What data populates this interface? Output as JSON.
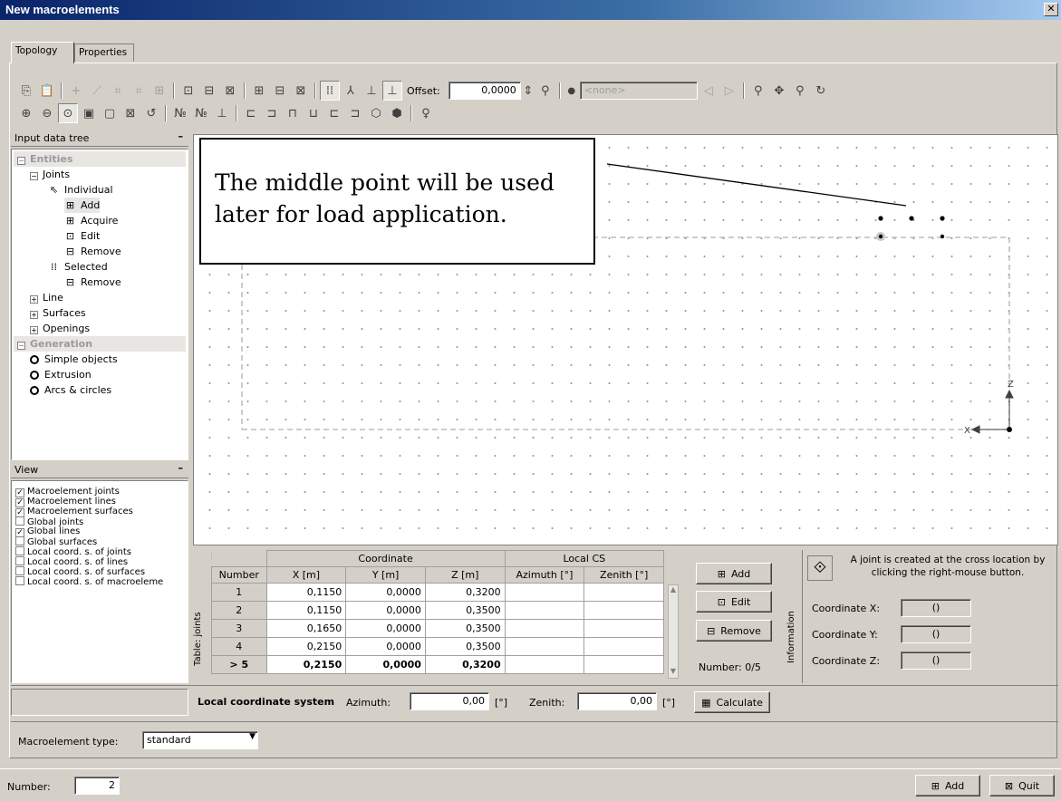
{
  "window": {
    "title": "New macroelements",
    "close_glyph": "✕"
  },
  "tabs": [
    {
      "label": "Topology",
      "active": true
    },
    {
      "label": "Properties",
      "active": false
    }
  ],
  "toolbar": {
    "offset_label": "Offset:",
    "offset_value": "0,0000",
    "none_select": "<none>"
  },
  "tree": {
    "header": "Input data tree",
    "items": [
      {
        "label": "Entities"
      },
      {
        "label": "Joints"
      },
      {
        "label": "Individual"
      },
      {
        "label": "Add"
      },
      {
        "label": "Acquire"
      },
      {
        "label": "Edit"
      },
      {
        "label": "Remove"
      },
      {
        "label": "Selected"
      },
      {
        "label": "Remove"
      },
      {
        "label": "Line"
      },
      {
        "label": "Surfaces"
      },
      {
        "label": "Openings"
      },
      {
        "label": "Generation"
      },
      {
        "label": "Simple objects"
      },
      {
        "label": "Extrusion"
      },
      {
        "label": "Arcs & circles"
      }
    ]
  },
  "view": {
    "header": "View",
    "items": [
      {
        "label": "Macroelement joints",
        "checked": true
      },
      {
        "label": "Macroelement lines",
        "checked": true
      },
      {
        "label": "Macroelement surfaces",
        "checked": true
      },
      {
        "label": "Global joints",
        "checked": false
      },
      {
        "label": "Global lines",
        "checked": true
      },
      {
        "label": "Global surfaces",
        "checked": false
      },
      {
        "label": "Local coord. s. of joints",
        "checked": false
      },
      {
        "label": "Local coord. s. of lines",
        "checked": false
      },
      {
        "label": "Local coord. s. of surfaces",
        "checked": false
      },
      {
        "label": "Local coord. s. of macroeleme",
        "checked": false
      }
    ]
  },
  "canvas": {
    "callout_text": "The middle point will be used later for load application.",
    "axis_z": "Z",
    "axis_x": "X"
  },
  "table": {
    "side_label": "Table: joints",
    "group_coordinate": "Coordinate",
    "group_local": "Local CS",
    "columns": [
      "Number",
      "X [m]",
      "Y [m]",
      "Z [m]",
      "Azimuth [°]",
      "Zenith [°]"
    ],
    "rows": [
      {
        "number": "1",
        "x": "0,1150",
        "y": "0,0000",
        "z": "0,3200",
        "az": "",
        "zen": ""
      },
      {
        "number": "2",
        "x": "0,1150",
        "y": "0,0000",
        "z": "0,3500",
        "az": "",
        "zen": ""
      },
      {
        "number": "3",
        "x": "0,1650",
        "y": "0,0000",
        "z": "0,3500",
        "az": "",
        "zen": ""
      },
      {
        "number": "4",
        "x": "0,2150",
        "y": "0,0000",
        "z": "0,3500",
        "az": "",
        "zen": ""
      },
      {
        "number": "> 5",
        "x": "0,2150",
        "y": "0,0000",
        "z": "0,3200",
        "az": "",
        "zen": ""
      }
    ]
  },
  "actions": {
    "add": "Add",
    "edit": "Edit",
    "remove": "Remove",
    "number": "Number: 0/5"
  },
  "info": {
    "side_label": "Information",
    "message": "A joint is created at the cross location by clicking the right-mouse button.",
    "coord_x_label": "Coordinate X:",
    "coord_y_label": "Coordinate Y:",
    "coord_z_label": "Coordinate Z:",
    "coord_x": "()",
    "coord_y": "()",
    "coord_z": "()"
  },
  "local_cs": {
    "title": "Local coordinate system",
    "azimuth_label": "Azimuth:",
    "azimuth": "0,00",
    "zenith_label": "Zenith:",
    "zenith": "0,00",
    "unit": "[°]",
    "calculate": "Calculate"
  },
  "macro_type": {
    "label": "Macroelement type:",
    "value": "standard"
  },
  "footer": {
    "number_label": "Number:",
    "number": "2",
    "add": "Add",
    "quit": "Quit"
  }
}
